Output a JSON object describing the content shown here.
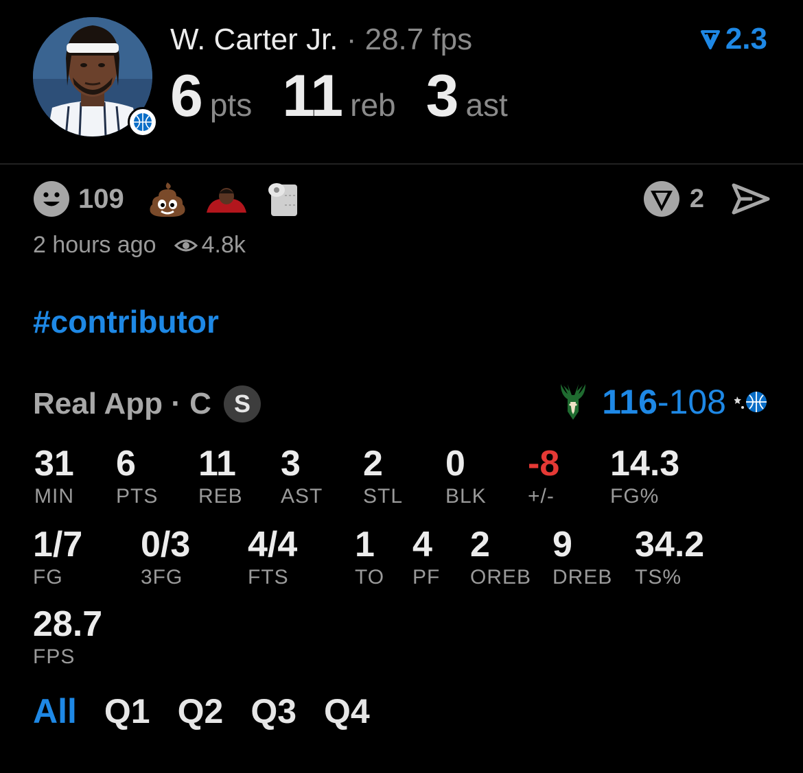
{
  "header": {
    "player_name": "W. Carter Jr.",
    "separator": " · ",
    "player_fps": "28.7 fps",
    "rating": "2.3",
    "pts_value": "6",
    "pts_unit": "pts",
    "reb_value": "11",
    "reb_unit": "reb",
    "ast_value": "3",
    "ast_unit": "ast"
  },
  "reactions": {
    "smiley_count": "109",
    "emojis": [
      "poop-emoji",
      "player-reaction-sticker",
      "toilet-paper-emoji"
    ],
    "share_count": "2"
  },
  "meta": {
    "time_ago": "2 hours ago",
    "views": "4.8k"
  },
  "post": {
    "hashtag": "#contributor"
  },
  "game": {
    "label": "Real App · C",
    "badge": "S",
    "score_win": "116",
    "score_sep": "-",
    "score_lose": "108"
  },
  "stats": [
    {
      "value": "31",
      "label": "MIN"
    },
    {
      "value": "6",
      "label": "PTS"
    },
    {
      "value": "11",
      "label": "REB"
    },
    {
      "value": "3",
      "label": "AST"
    },
    {
      "value": "2",
      "label": "STL"
    },
    {
      "value": "0",
      "label": "BLK"
    },
    {
      "value": "-8",
      "label": "+/-"
    },
    {
      "value": "14.3",
      "label": "FG%"
    },
    {
      "value": "1/7",
      "label": "FG"
    },
    {
      "value": "0/3",
      "label": "3FG"
    },
    {
      "value": "4/4",
      "label": "FTS"
    },
    {
      "value": "1",
      "label": "TO"
    },
    {
      "value": "4",
      "label": "PF"
    },
    {
      "value": "2",
      "label": "OREB"
    },
    {
      "value": "9",
      "label": "DREB"
    },
    {
      "value": "34.2",
      "label": "TS%"
    },
    {
      "value": "28.7",
      "label": "FPS"
    }
  ],
  "tabs": [
    "All",
    "Q1",
    "Q2",
    "Q3",
    "Q4"
  ],
  "colors": {
    "accent": "#1e88e5",
    "negative": "#e53935",
    "background": "#000000"
  }
}
